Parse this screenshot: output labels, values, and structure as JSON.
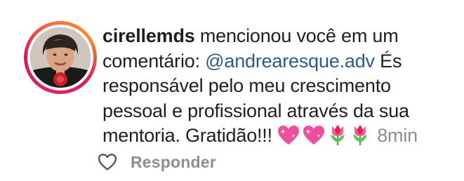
{
  "comment": {
    "username": "cirellemds",
    "text_before_mention": " mencionou você em um comentário: ",
    "mention": "@andrearesque.adv",
    "text_after_mention": " És responsável pelo meu crescimento pessoal e profissional através da sua mentoria. Gratidão!!! ",
    "emojis": [
      "sparkling-heart-icon",
      "sparkling-heart-icon",
      "tulip-icon",
      "tulip-icon"
    ],
    "timestamp": "8min"
  },
  "actions": {
    "like_icon": "heart-outline-icon",
    "reply_label": "Responder"
  },
  "colors": {
    "mention": "#2f5a86",
    "muted": "#8e8e8e",
    "text": "#1f1f1f",
    "story_ring": "#e91e63"
  }
}
